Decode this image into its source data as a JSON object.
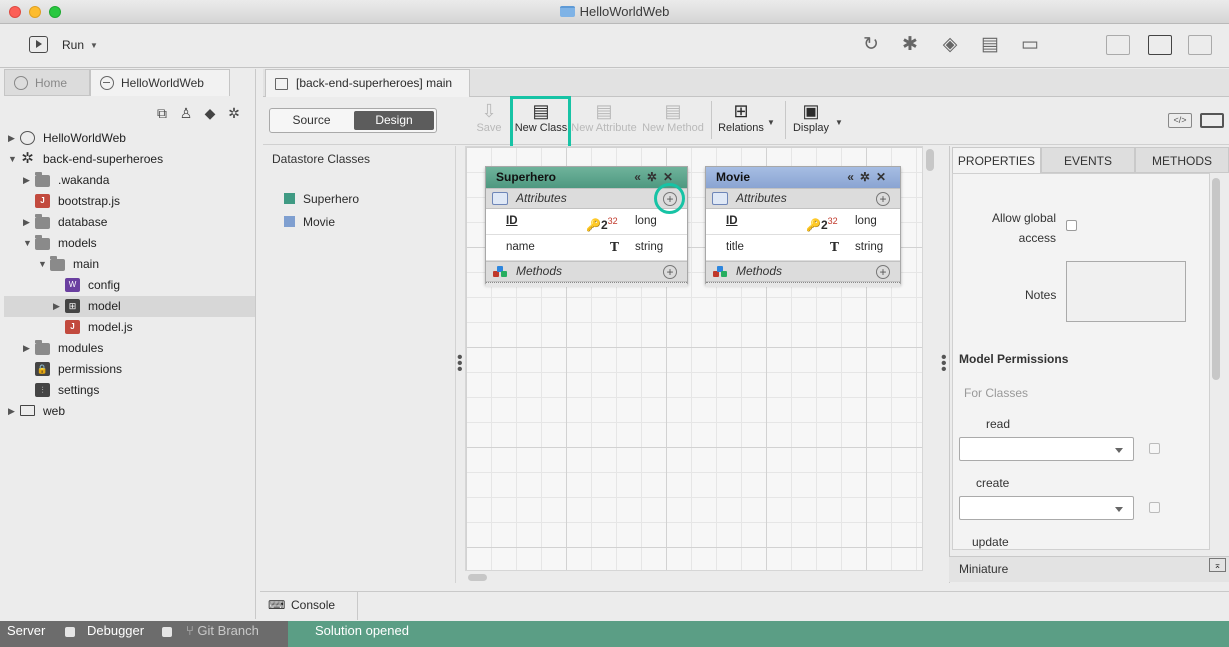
{
  "window": {
    "title": "HelloWorldWeb"
  },
  "toolbar": {
    "run_label": "Run"
  },
  "sidebar": {
    "tabs": [
      "Home",
      "HelloWorldWeb"
    ],
    "tree": [
      {
        "label": "HelloWorldWeb",
        "icon": "project-icon",
        "expanded": false
      },
      {
        "label": "back-end-superheroes",
        "icon": "gear-icon",
        "expanded": true
      },
      {
        "label": ".wakanda",
        "icon": "folder-icon",
        "expanded": false
      },
      {
        "label": "bootstrap.js",
        "icon": "js-file-icon"
      },
      {
        "label": "database",
        "icon": "folder-icon",
        "expanded": false
      },
      {
        "label": "models",
        "icon": "folder-icon",
        "expanded": true
      },
      {
        "label": "main",
        "icon": "folder-icon",
        "expanded": true
      },
      {
        "label": "config",
        "icon": "config-file-icon"
      },
      {
        "label": "model",
        "icon": "model-file-icon",
        "selected": true
      },
      {
        "label": "model.js",
        "icon": "js-file-icon"
      },
      {
        "label": "modules",
        "icon": "folder-icon",
        "expanded": false
      },
      {
        "label": "permissions",
        "icon": "lock-icon"
      },
      {
        "label": "settings",
        "icon": "settings-icon"
      },
      {
        "label": "web",
        "icon": "monitor-icon",
        "expanded": false
      }
    ]
  },
  "document": {
    "tab_label": "[back-end-superheroes] main",
    "mode_source": "Source",
    "mode_design": "Design",
    "buttons": {
      "save": "Save",
      "new_class": "New Class",
      "new_attribute": "New Attribute",
      "new_method": "New Method",
      "relations": "Relations",
      "display": "Display"
    }
  },
  "datastore": {
    "title": "Datastore Classes",
    "classes": [
      {
        "name": "Superhero",
        "color": "#3f9a83"
      },
      {
        "name": "Movie",
        "color": "#7f9fd0"
      }
    ]
  },
  "diagram": {
    "classes": [
      {
        "name": "Superhero",
        "header_color": "#5a9f88",
        "attributes_label": "Attributes",
        "methods_label": "Methods",
        "attributes": [
          {
            "name": "ID",
            "type": "long",
            "key": true,
            "icon_text": "2",
            "icon_sup": "32"
          },
          {
            "name": "name",
            "type": "string",
            "key": false,
            "icon_text": "T"
          }
        ]
      },
      {
        "name": "Movie",
        "header_color": "#8fa9d6",
        "attributes_label": "Attributes",
        "methods_label": "Methods",
        "attributes": [
          {
            "name": "ID",
            "type": "long",
            "key": true,
            "icon_text": "2",
            "icon_sup": "32"
          },
          {
            "name": "title",
            "type": "string",
            "key": false,
            "icon_text": "T"
          }
        ]
      }
    ]
  },
  "properties": {
    "tabs": [
      "PROPERTIES",
      "EVENTS",
      "METHODS"
    ],
    "allow_global_access_label": "Allow global\naccess",
    "notes_label": "Notes",
    "model_permissions_title": "Model Permissions",
    "for_classes_label": "For Classes",
    "permissions": [
      "read",
      "create",
      "update"
    ],
    "miniature_label": "Miniature"
  },
  "console": {
    "label": "Console"
  },
  "statusbar": {
    "server": "Server",
    "debugger": "Debugger",
    "git_branch": "Git Branch",
    "message": "Solution opened"
  },
  "colors": {
    "accent_highlight": "#17c3a5",
    "status_green": "#5b9e85"
  }
}
